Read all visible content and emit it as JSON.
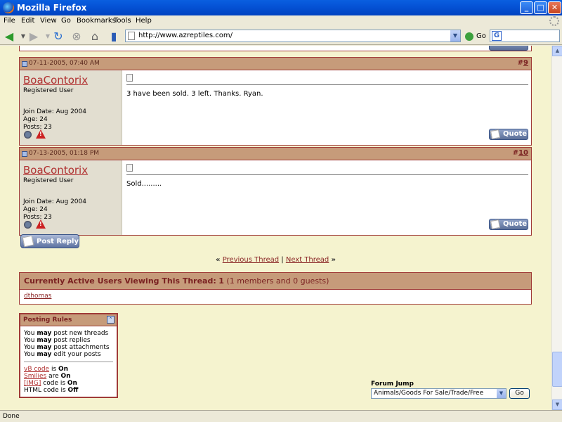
{
  "window": {
    "title": "Mozilla Firefox"
  },
  "menu": [
    "File",
    "Edit",
    "View",
    "Go",
    "Bookmarks",
    "Tools",
    "Help"
  ],
  "address": {
    "url": "http://www.azreptiles.com/",
    "go_label": "Go"
  },
  "posts": [
    {
      "date": "07-11-2005, 07:40 AM",
      "number_prefix": "#",
      "number": "9",
      "username": "BoaContorix",
      "user_title": "Registered User",
      "join_date": "Join Date: Aug 2004",
      "age": "Age: 24",
      "posts": "Posts: 23",
      "message": "3 have been sold. 3 left. Thanks. Ryan.",
      "quote_label": "Quote"
    },
    {
      "date": "07-13-2005, 01:18 PM",
      "number_prefix": "#",
      "number": "10",
      "username": "BoaContorix",
      "user_title": "Registered User",
      "join_date": "Join Date: Aug 2004",
      "age": "Age: 24",
      "posts": "Posts: 23",
      "message": "Sold.........",
      "quote_label": "Quote"
    }
  ],
  "post_reply_label": "Post Reply",
  "thread_nav": {
    "left_arrows": "«",
    "prev": "Previous Thread",
    "sep": "|",
    "next": "Next Thread",
    "right_arrows": "»"
  },
  "active_users": {
    "title": "Currently Active Users Viewing This Thread:",
    "count": "1",
    "detail": "(1 members and 0 guests)",
    "users": [
      "dthomas"
    ]
  },
  "posting_rules": {
    "title": "Posting Rules",
    "collapse_icon": "collapse-icon",
    "lines": [
      {
        "pre": "You ",
        "bold": "may",
        "post": " post new threads"
      },
      {
        "pre": "You ",
        "bold": "may",
        "post": " post replies"
      },
      {
        "pre": "You ",
        "bold": "may",
        "post": " post attachments"
      },
      {
        "pre": "You ",
        "bold": "may",
        "post": " edit your posts"
      }
    ],
    "codes": [
      {
        "link": "vB code",
        "mid": " is ",
        "state": "On"
      },
      {
        "link": "Smilies",
        "mid": " are ",
        "state": "On"
      },
      {
        "link": "[IMG]",
        "mid": " code is ",
        "state": "On"
      },
      {
        "text": "HTML code is ",
        "state": "Off"
      }
    ]
  },
  "forum_jump": {
    "label": "Forum Jump",
    "selected": "Animals/Goods For Sale/Trade/Free",
    "go_label": "Go"
  },
  "status": "Done"
}
